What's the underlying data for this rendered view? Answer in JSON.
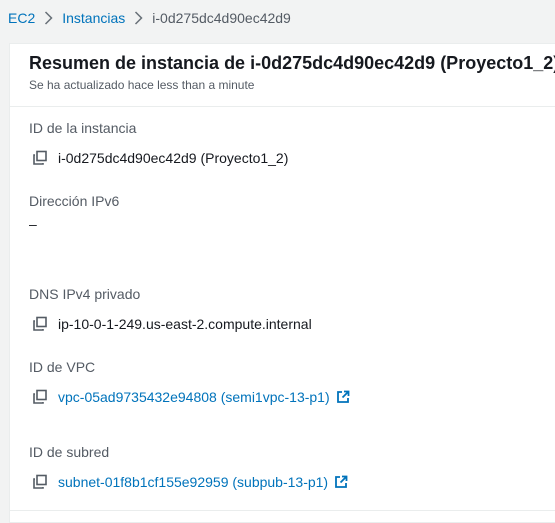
{
  "breadcrumb": {
    "items": [
      "EC2",
      "Instancias",
      "i-0d275dc4d90ec42d9"
    ]
  },
  "header": {
    "title": "Resumen de instancia de i-0d275dc4d90ec42d9 (Proyecto1_2)",
    "subtitle": "Se ha actualizado hace less than a minute"
  },
  "fields": {
    "instance_id": {
      "label": "ID de la instancia",
      "value": "i-0d275dc4d90ec42d9 (Proyecto1_2)"
    },
    "ipv6": {
      "label": "Dirección IPv6",
      "value": "–"
    },
    "private_dns": {
      "label": "DNS IPv4 privado",
      "value": "ip-10-0-1-249.us-east-2.compute.internal"
    },
    "vpc": {
      "label": "ID de VPC",
      "value": "vpc-05ad9735432e94808 (semi1vpc-13-p1)"
    },
    "subnet": {
      "label": "ID de subred",
      "value": "subnet-01f8b1cf155e92959 (subpub-13-p1)"
    }
  },
  "icons": {
    "copy": "copy-icon",
    "external": "external-link-icon",
    "separator": "chevron-right-icon"
  },
  "colors": {
    "link": "#0073bb",
    "text": "#16191f",
    "muted": "#545b64",
    "background": "#f2f3f3"
  }
}
